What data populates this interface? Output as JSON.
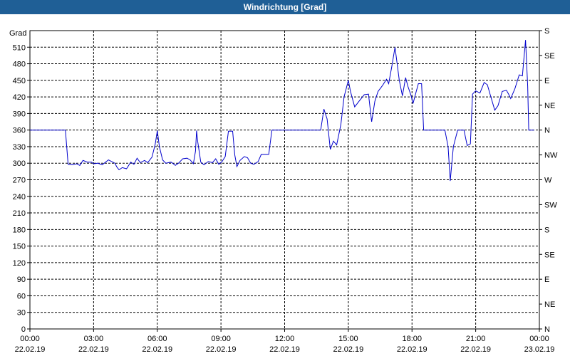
{
  "window": {
    "title": "Windrichtung [Grad]"
  },
  "chart_data": {
    "type": "line",
    "title": "Windrichtung [Grad]",
    "ylabel": "Grad",
    "xlabel": "",
    "ylim": [
      0,
      540
    ],
    "y_ticks": [
      0,
      30,
      60,
      90,
      120,
      150,
      180,
      210,
      240,
      270,
      300,
      330,
      360,
      390,
      420,
      450,
      480,
      510
    ],
    "right_ticks": [
      {
        "value": 0,
        "label": "N"
      },
      {
        "value": 45,
        "label": "NE"
      },
      {
        "value": 90,
        "label": "E"
      },
      {
        "value": 135,
        "label": "SE"
      },
      {
        "value": 180,
        "label": "S"
      },
      {
        "value": 225,
        "label": "SW"
      },
      {
        "value": 270,
        "label": "W"
      },
      {
        "value": 315,
        "label": "NW"
      },
      {
        "value": 360,
        "label": "N"
      },
      {
        "value": 405,
        "label": "NE"
      },
      {
        "value": 450,
        "label": "E"
      },
      {
        "value": 495,
        "label": "SE"
      },
      {
        "value": 540,
        "label": "S"
      }
    ],
    "x_ticks": [
      {
        "hour": 0,
        "time": "00:00",
        "date": "22.02.19"
      },
      {
        "hour": 3,
        "time": "03:00",
        "date": "22.02.19"
      },
      {
        "hour": 6,
        "time": "06:00",
        "date": "22.02.19"
      },
      {
        "hour": 9,
        "time": "09:00",
        "date": "22.02.19"
      },
      {
        "hour": 12,
        "time": "12:00",
        "date": "22.02.19"
      },
      {
        "hour": 15,
        "time": "15:00",
        "date": "22.02.19"
      },
      {
        "hour": 18,
        "time": "18:00",
        "date": "22.02.19"
      },
      {
        "hour": 21,
        "time": "21:00",
        "date": "22.02.19"
      },
      {
        "hour": 24,
        "time": "00:00",
        "date": "23.02.19"
      }
    ],
    "xlim": [
      0,
      24
    ],
    "grid": true,
    "line_color": "#0000cc",
    "series": [
      {
        "values": [
          [
            0.0,
            360
          ],
          [
            1.67,
            360
          ],
          [
            1.8,
            298
          ],
          [
            2.0,
            297
          ],
          [
            2.2,
            299
          ],
          [
            2.35,
            296
          ],
          [
            2.5,
            305
          ],
          [
            2.7,
            302
          ],
          [
            2.9,
            302
          ],
          [
            3.0,
            299
          ],
          [
            3.2,
            300
          ],
          [
            3.4,
            297
          ],
          [
            3.7,
            306
          ],
          [
            4.0,
            300
          ],
          [
            4.1,
            293
          ],
          [
            4.2,
            288
          ],
          [
            4.35,
            292
          ],
          [
            4.55,
            290
          ],
          [
            4.75,
            302
          ],
          [
            4.9,
            298
          ],
          [
            5.05,
            309
          ],
          [
            5.2,
            301
          ],
          [
            5.4,
            305
          ],
          [
            5.55,
            301
          ],
          [
            5.75,
            311
          ],
          [
            5.9,
            334
          ],
          [
            6.0,
            359
          ],
          [
            6.1,
            330
          ],
          [
            6.25,
            306
          ],
          [
            6.4,
            300
          ],
          [
            6.65,
            302
          ],
          [
            6.85,
            296
          ],
          [
            7.0,
            300
          ],
          [
            7.2,
            308
          ],
          [
            7.4,
            309
          ],
          [
            7.55,
            306
          ],
          [
            7.7,
            299
          ],
          [
            7.8,
            322
          ],
          [
            7.85,
            359
          ],
          [
            7.9,
            340
          ],
          [
            8.05,
            302
          ],
          [
            8.2,
            297
          ],
          [
            8.4,
            303
          ],
          [
            8.6,
            301
          ],
          [
            8.75,
            308
          ],
          [
            8.9,
            298
          ],
          [
            9.05,
            303
          ],
          [
            9.2,
            312
          ],
          [
            9.35,
            358
          ],
          [
            9.55,
            358
          ],
          [
            9.65,
            315
          ],
          [
            9.75,
            294
          ],
          [
            9.9,
            305
          ],
          [
            10.1,
            312
          ],
          [
            10.25,
            310
          ],
          [
            10.4,
            300
          ],
          [
            10.55,
            298
          ],
          [
            10.75,
            303
          ],
          [
            10.9,
            316
          ],
          [
            11.25,
            316
          ],
          [
            11.4,
            360
          ],
          [
            13.7,
            360
          ],
          [
            13.85,
            398
          ],
          [
            14.0,
            380
          ],
          [
            14.15,
            325
          ],
          [
            14.3,
            340
          ],
          [
            14.45,
            333
          ],
          [
            14.65,
            370
          ],
          [
            14.8,
            420
          ],
          [
            15.0,
            450
          ],
          [
            15.1,
            430
          ],
          [
            15.3,
            402
          ],
          [
            15.5,
            412
          ],
          [
            15.75,
            424
          ],
          [
            15.95,
            425
          ],
          [
            16.1,
            375
          ],
          [
            16.25,
            412
          ],
          [
            16.4,
            430
          ],
          [
            16.6,
            440
          ],
          [
            16.8,
            452
          ],
          [
            16.9,
            444
          ],
          [
            17.05,
            475
          ],
          [
            17.2,
            510
          ],
          [
            17.3,
            480
          ],
          [
            17.4,
            450
          ],
          [
            17.55,
            422
          ],
          [
            17.7,
            455
          ],
          [
            17.8,
            440
          ],
          [
            17.95,
            423
          ],
          [
            18.05,
            408
          ],
          [
            18.2,
            430
          ],
          [
            18.3,
            444
          ],
          [
            18.45,
            444
          ],
          [
            18.55,
            360
          ],
          [
            19.55,
            360
          ],
          [
            19.7,
            330
          ],
          [
            19.8,
            268
          ],
          [
            19.95,
            330
          ],
          [
            20.15,
            360
          ],
          [
            20.45,
            360
          ],
          [
            20.6,
            332
          ],
          [
            20.75,
            335
          ],
          [
            20.85,
            425
          ],
          [
            21.0,
            431
          ],
          [
            21.2,
            427
          ],
          [
            21.4,
            446
          ],
          [
            21.55,
            442
          ],
          [
            21.7,
            422
          ],
          [
            21.9,
            396
          ],
          [
            22.05,
            404
          ],
          [
            22.25,
            430
          ],
          [
            22.45,
            432
          ],
          [
            22.55,
            425
          ],
          [
            22.65,
            417
          ],
          [
            22.85,
            435
          ],
          [
            23.05,
            460
          ],
          [
            23.2,
            458
          ],
          [
            23.35,
            523
          ],
          [
            23.45,
            440
          ],
          [
            23.5,
            360
          ],
          [
            23.75,
            360
          ]
        ]
      }
    ]
  }
}
